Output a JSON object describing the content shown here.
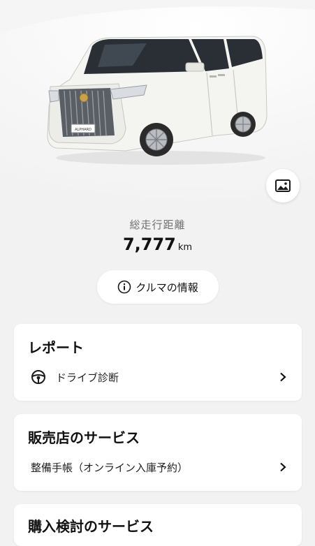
{
  "hero": {
    "mileage_label": "総走行距離",
    "mileage_value": "7,777",
    "mileage_unit": "km",
    "car_info_button": "クルマの情報",
    "car_emblem_text": "ALPHARD"
  },
  "cards": [
    {
      "title": "レポート",
      "items": [
        {
          "label": "ドライブ診断",
          "icon": "steering-wheel-icon"
        }
      ]
    },
    {
      "title": "販売店のサービス",
      "items": [
        {
          "label": "整備手帳（オンライン入庫予約）",
          "icon": ""
        }
      ]
    },
    {
      "title": "購入検討のサービス",
      "items": []
    }
  ],
  "icons": {
    "photo": "image-icon",
    "info": "info-icon",
    "chevron": "chevron-right-icon"
  },
  "colors": {
    "brand_red": "#d41c24",
    "background": "#f2f2f2",
    "card": "#ffffff"
  }
}
